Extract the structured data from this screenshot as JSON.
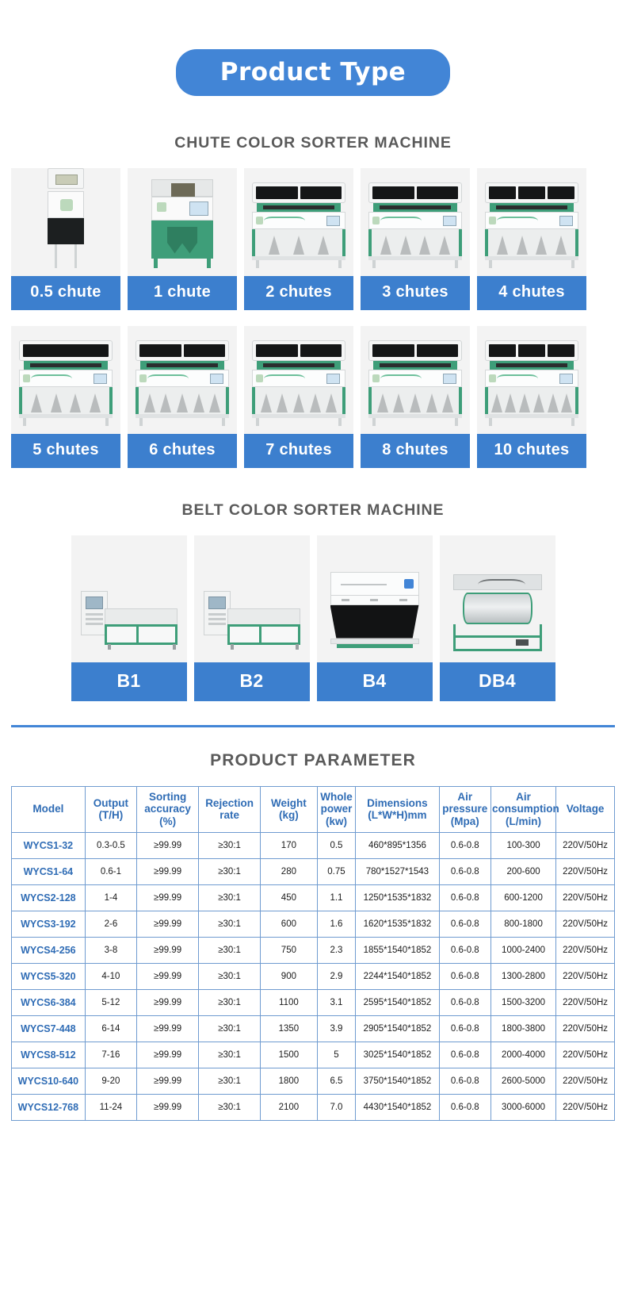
{
  "header": {
    "badge": "Product Type",
    "badge_color": "#4285d6"
  },
  "sections": {
    "chute_title": "CHUTE COLOR SORTER MACHINE",
    "belt_title": "BELT COLOR SORTER MACHINE",
    "param_title": "PRODUCT PARAMETER"
  },
  "chute_row1": [
    {
      "label": "0.5 chute"
    },
    {
      "label": "1 chute"
    },
    {
      "label": "2 chutes"
    },
    {
      "label": "3 chutes"
    },
    {
      "label": "4 chutes"
    }
  ],
  "chute_row2": [
    {
      "label": "5 chutes"
    },
    {
      "label": "6 chutes"
    },
    {
      "label": "7 chutes"
    },
    {
      "label": "8 chutes"
    },
    {
      "label": "10 chutes"
    }
  ],
  "belt_items": [
    {
      "label": "B1"
    },
    {
      "label": "B2"
    },
    {
      "label": "B4"
    },
    {
      "label": "DB4"
    }
  ],
  "chart_data": {
    "type": "table",
    "title": "PRODUCT PARAMETER",
    "columns": [
      "Model",
      "Output (T/H)",
      "Sorting accuracy (%)",
      "Rejection rate",
      "Weight (kg)",
      "Whole power (kw)",
      "Dimensions (L*W*H)mm",
      "Air pressure (Mpa)",
      "Air consumption (L/min)",
      "Voltage"
    ],
    "columns_multiline": [
      [
        "Model"
      ],
      [
        "Output",
        "(T/H)"
      ],
      [
        "Sorting",
        "accuracy",
        "(%)"
      ],
      [
        "Rejection",
        "rate"
      ],
      [
        "Weight",
        "(kg)"
      ],
      [
        "Whole",
        "power",
        "(kw)"
      ],
      [
        "Dimensions",
        "(L*W*H)mm"
      ],
      [
        "Air",
        "pressure",
        "(Mpa)"
      ],
      [
        "Air",
        "consumption",
        "(L/min)"
      ],
      [
        "Voltage"
      ]
    ],
    "rows": [
      [
        "WYCS1-32",
        "0.3-0.5",
        "≥99.99",
        "≥30:1",
        "170",
        "0.5",
        "460*895*1356",
        "0.6-0.8",
        "100-300",
        "220V/50Hz"
      ],
      [
        "WYCS1-64",
        "0.6-1",
        "≥99.99",
        "≥30:1",
        "280",
        "0.75",
        "780*1527*1543",
        "0.6-0.8",
        "200-600",
        "220V/50Hz"
      ],
      [
        "WYCS2-128",
        "1-4",
        "≥99.99",
        "≥30:1",
        "450",
        "1.1",
        "1250*1535*1832",
        "0.6-0.8",
        "600-1200",
        "220V/50Hz"
      ],
      [
        "WYCS3-192",
        "2-6",
        "≥99.99",
        "≥30:1",
        "600",
        "1.6",
        "1620*1535*1832",
        "0.6-0.8",
        "800-1800",
        "220V/50Hz"
      ],
      [
        "WYCS4-256",
        "3-8",
        "≥99.99",
        "≥30:1",
        "750",
        "2.3",
        "1855*1540*1852",
        "0.6-0.8",
        "1000-2400",
        "220V/50Hz"
      ],
      [
        "WYCS5-320",
        "4-10",
        "≥99.99",
        "≥30:1",
        "900",
        "2.9",
        "2244*1540*1852",
        "0.6-0.8",
        "1300-2800",
        "220V/50Hz"
      ],
      [
        "WYCS6-384",
        "5-12",
        "≥99.99",
        "≥30:1",
        "1100",
        "3.1",
        "2595*1540*1852",
        "0.6-0.8",
        "1500-3200",
        "220V/50Hz"
      ],
      [
        "WYCS7-448",
        "6-14",
        "≥99.99",
        "≥30:1",
        "1350",
        "3.9",
        "2905*1540*1852",
        "0.6-0.8",
        "1800-3800",
        "220V/50Hz"
      ],
      [
        "WYCS8-512",
        "7-16",
        "≥99.99",
        "≥30:1",
        "1500",
        "5",
        "3025*1540*1852",
        "0.6-0.8",
        "2000-4000",
        "220V/50Hz"
      ],
      [
        "WYCS10-640",
        "9-20",
        "≥99.99",
        "≥30:1",
        "1800",
        "6.5",
        "3750*1540*1852",
        "0.6-0.8",
        "2600-5000",
        "220V/50Hz"
      ],
      [
        "WYCS12-768",
        "11-24",
        "≥99.99",
        "≥30:1",
        "2100",
        "7.0",
        "4430*1540*1852",
        "0.6-0.8",
        "3000-6000",
        "220V/50Hz"
      ]
    ]
  },
  "colors": {
    "accent_blue": "#4285d6",
    "label_blue": "#3c7fce",
    "table_text_blue": "#2f6cb5",
    "table_border_blue": "#6f9bd0",
    "title_gray": "#5a5a5a",
    "machine_green": "#3e9e79"
  }
}
